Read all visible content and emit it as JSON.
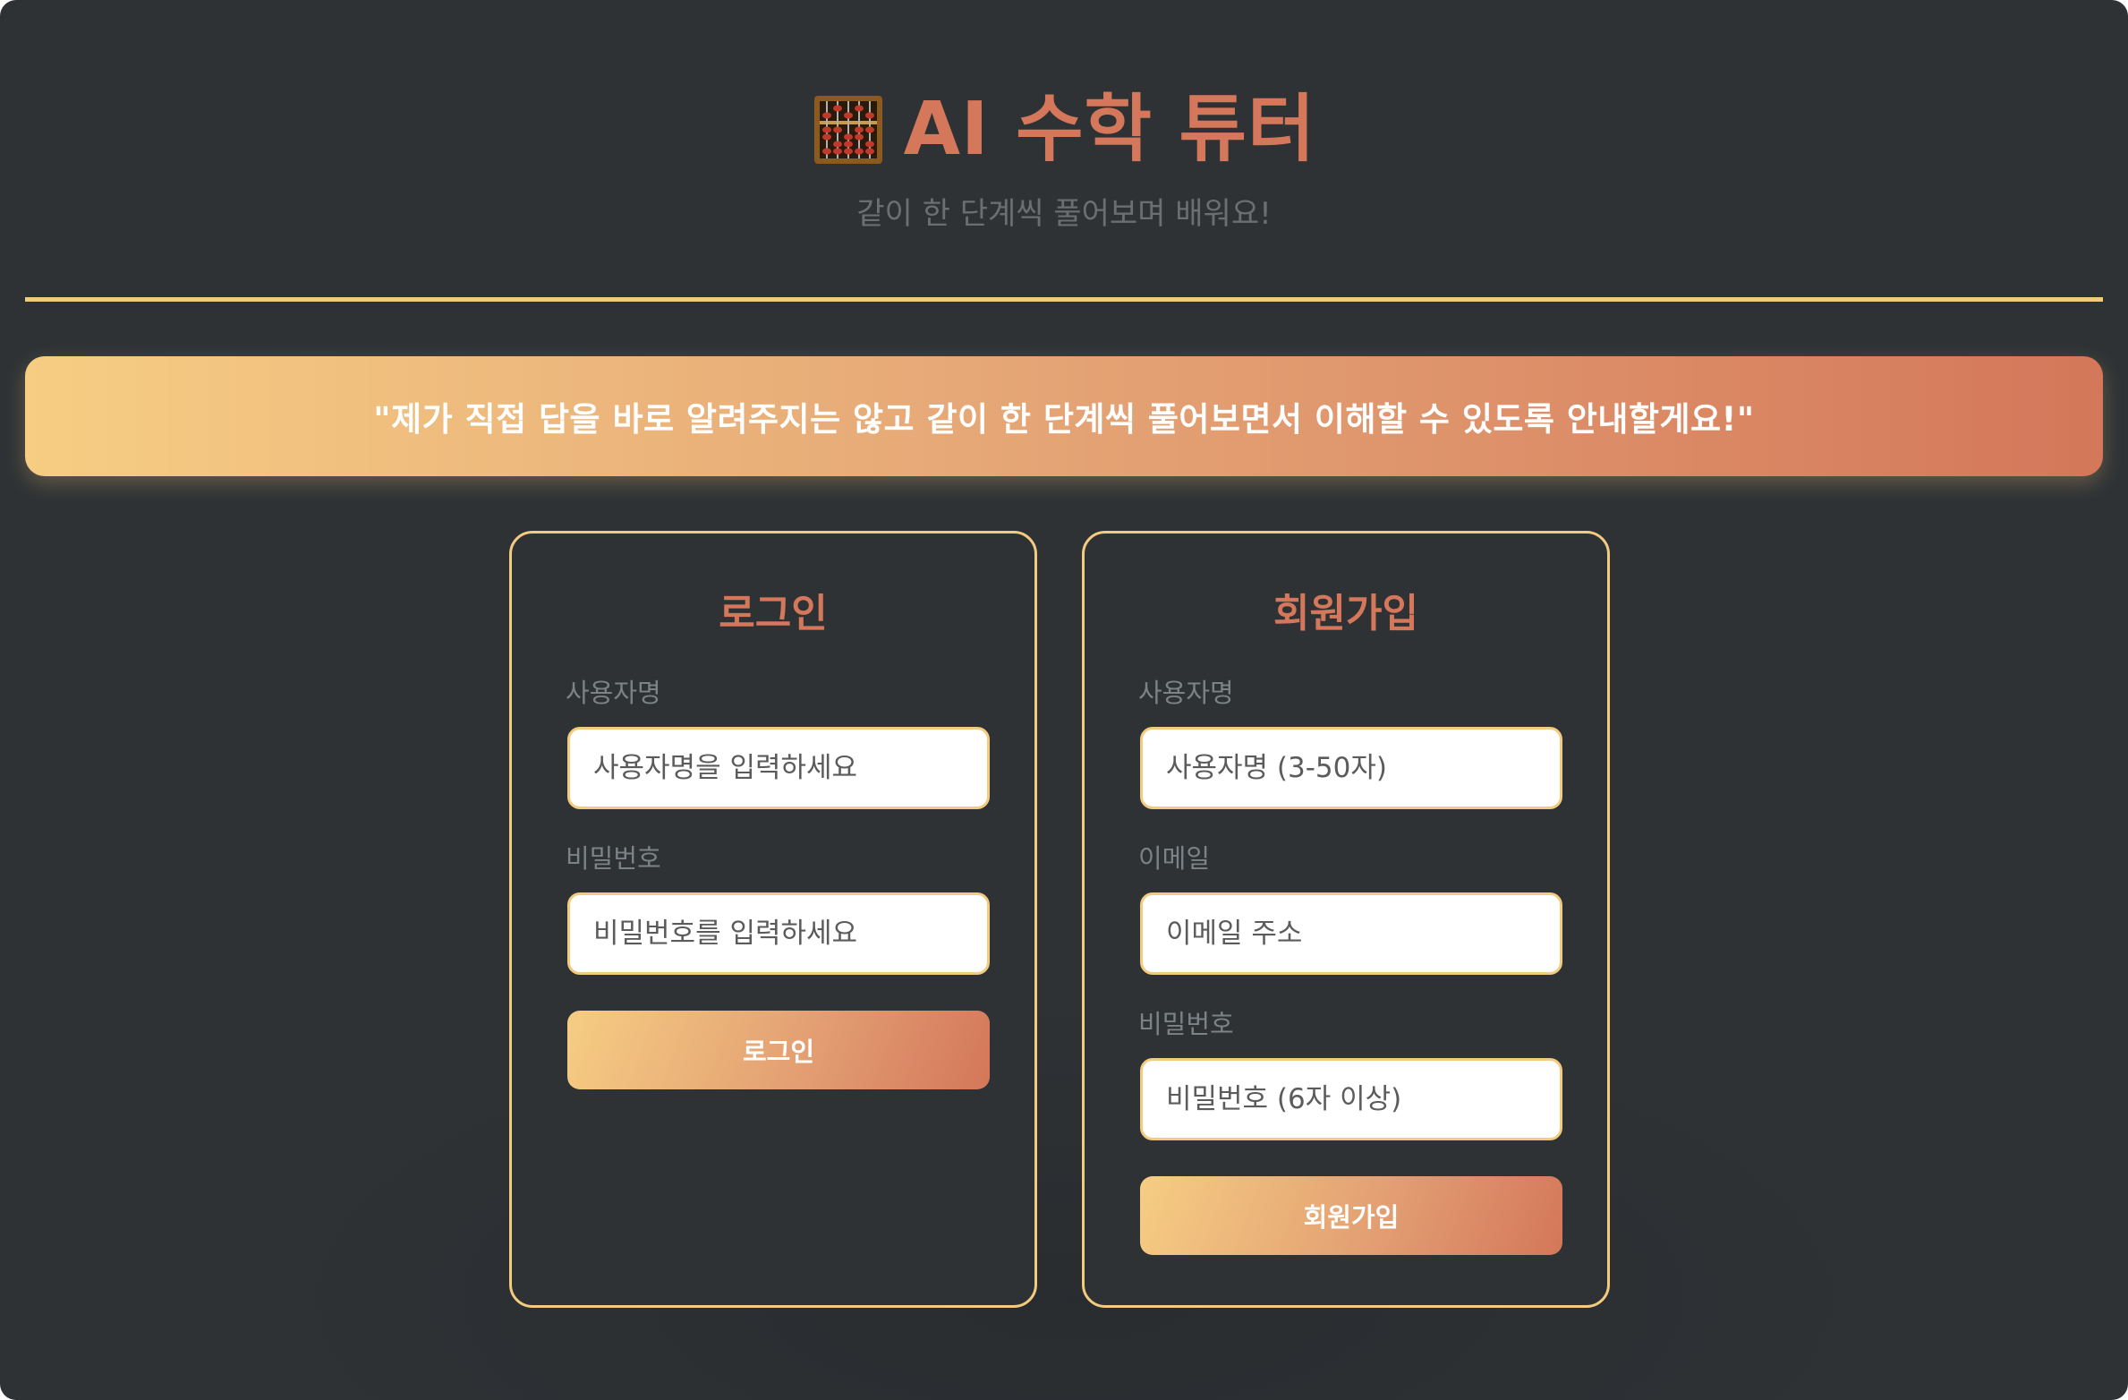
{
  "header": {
    "icon": "abacus-icon",
    "title": "AI 수학 튜터",
    "subtitle": "같이 한 단계씩 풀어보며 배워요!"
  },
  "banner": {
    "text": "\"제가 직접 답을 바로 알려주지는 않고 같이 한 단계씩 풀어보면서 이해할 수 있도록 안내할게요!\""
  },
  "login": {
    "title": "로그인",
    "username_label": "사용자명",
    "username_placeholder": "사용자명을 입력하세요",
    "password_label": "비밀번호",
    "password_placeholder": "비밀번호를 입력하세요",
    "submit_label": "로그인"
  },
  "signup": {
    "title": "회원가입",
    "username_label": "사용자명",
    "username_placeholder": "사용자명 (3-50자)",
    "email_label": "이메일",
    "email_placeholder": "이메일 주소",
    "password_label": "비밀번호",
    "password_placeholder": "비밀번호 (6자 이상)",
    "submit_label": "회원가입"
  },
  "colors": {
    "background": "#2e3235",
    "accent": "#d4775a",
    "gold": "#f3cb80",
    "subtitle": "#6b6f71",
    "label": "#7d8285"
  }
}
